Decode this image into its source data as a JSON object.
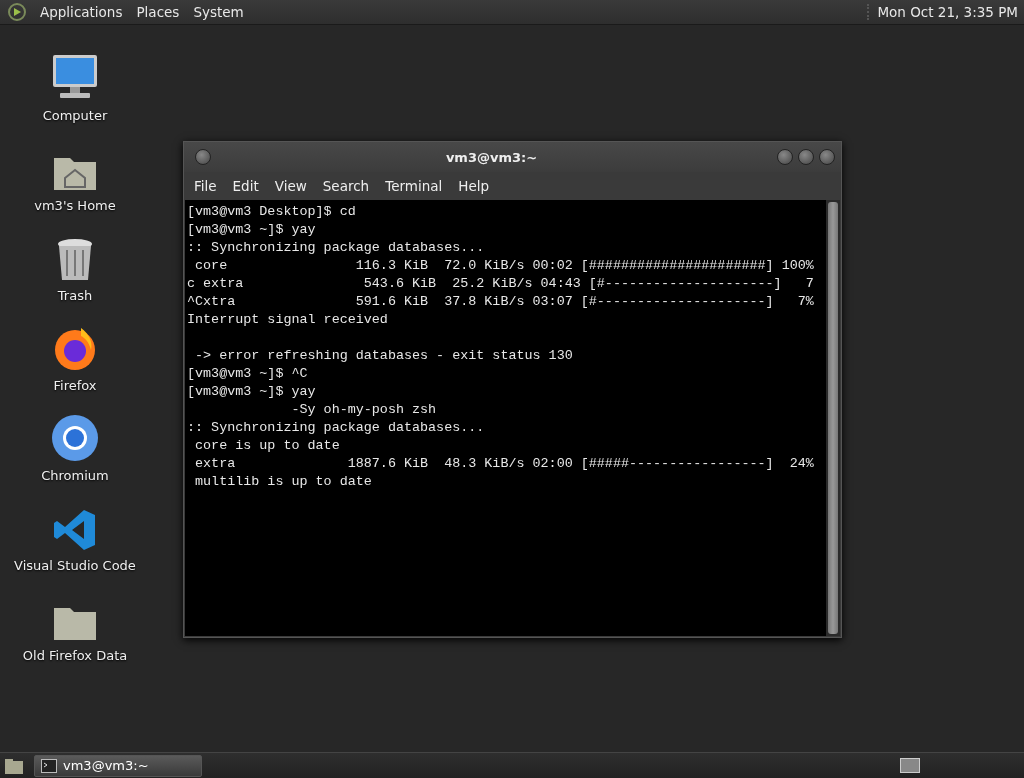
{
  "top_panel": {
    "menus": [
      "Applications",
      "Places",
      "System"
    ],
    "clock": "Mon Oct 21,  3:35 PM"
  },
  "desktop_icons": [
    {
      "label": "Computer",
      "kind": "computer"
    },
    {
      "label": "vm3's Home",
      "kind": "home"
    },
    {
      "label": "Trash",
      "kind": "trash"
    },
    {
      "label": "Firefox",
      "kind": "firefox"
    },
    {
      "label": "Chromium",
      "kind": "chromium"
    },
    {
      "label": "Visual Studio Code",
      "kind": "vscode"
    },
    {
      "label": "Old Firefox Data",
      "kind": "folder"
    }
  ],
  "terminal": {
    "title": "vm3@vm3:~",
    "menu": [
      "File",
      "Edit",
      "View",
      "Search",
      "Terminal",
      "Help"
    ],
    "lines": [
      "[vm3@vm3 Desktop]$ cd",
      "[vm3@vm3 ~]$ yay",
      ":: Synchronizing package databases...",
      " core                116.3 KiB  72.0 KiB/s 00:02 [######################] 100%",
      "c extra               543.6 KiB  25.2 KiB/s 04:43 [#---------------------]   7",
      "^Cxtra               591.6 KiB  37.8 KiB/s 03:07 [#---------------------]   7%",
      "Interrupt signal received",
      {
        "text": " -> error refreshing databases - exit status 130",
        "gap_before": true
      },
      "[vm3@vm3 ~]$ ^C",
      "[vm3@vm3 ~]$ yay",
      "             -Sy oh-my-posh zsh",
      ":: Synchronizing package databases...",
      " core is up to date",
      " extra              1887.6 KiB  48.3 KiB/s 02:00 [#####-----------------]  24%",
      " multilib is up to date"
    ]
  },
  "taskbar": {
    "tasks": [
      {
        "label": "vm3@vm3:~",
        "selected": true
      }
    ]
  }
}
